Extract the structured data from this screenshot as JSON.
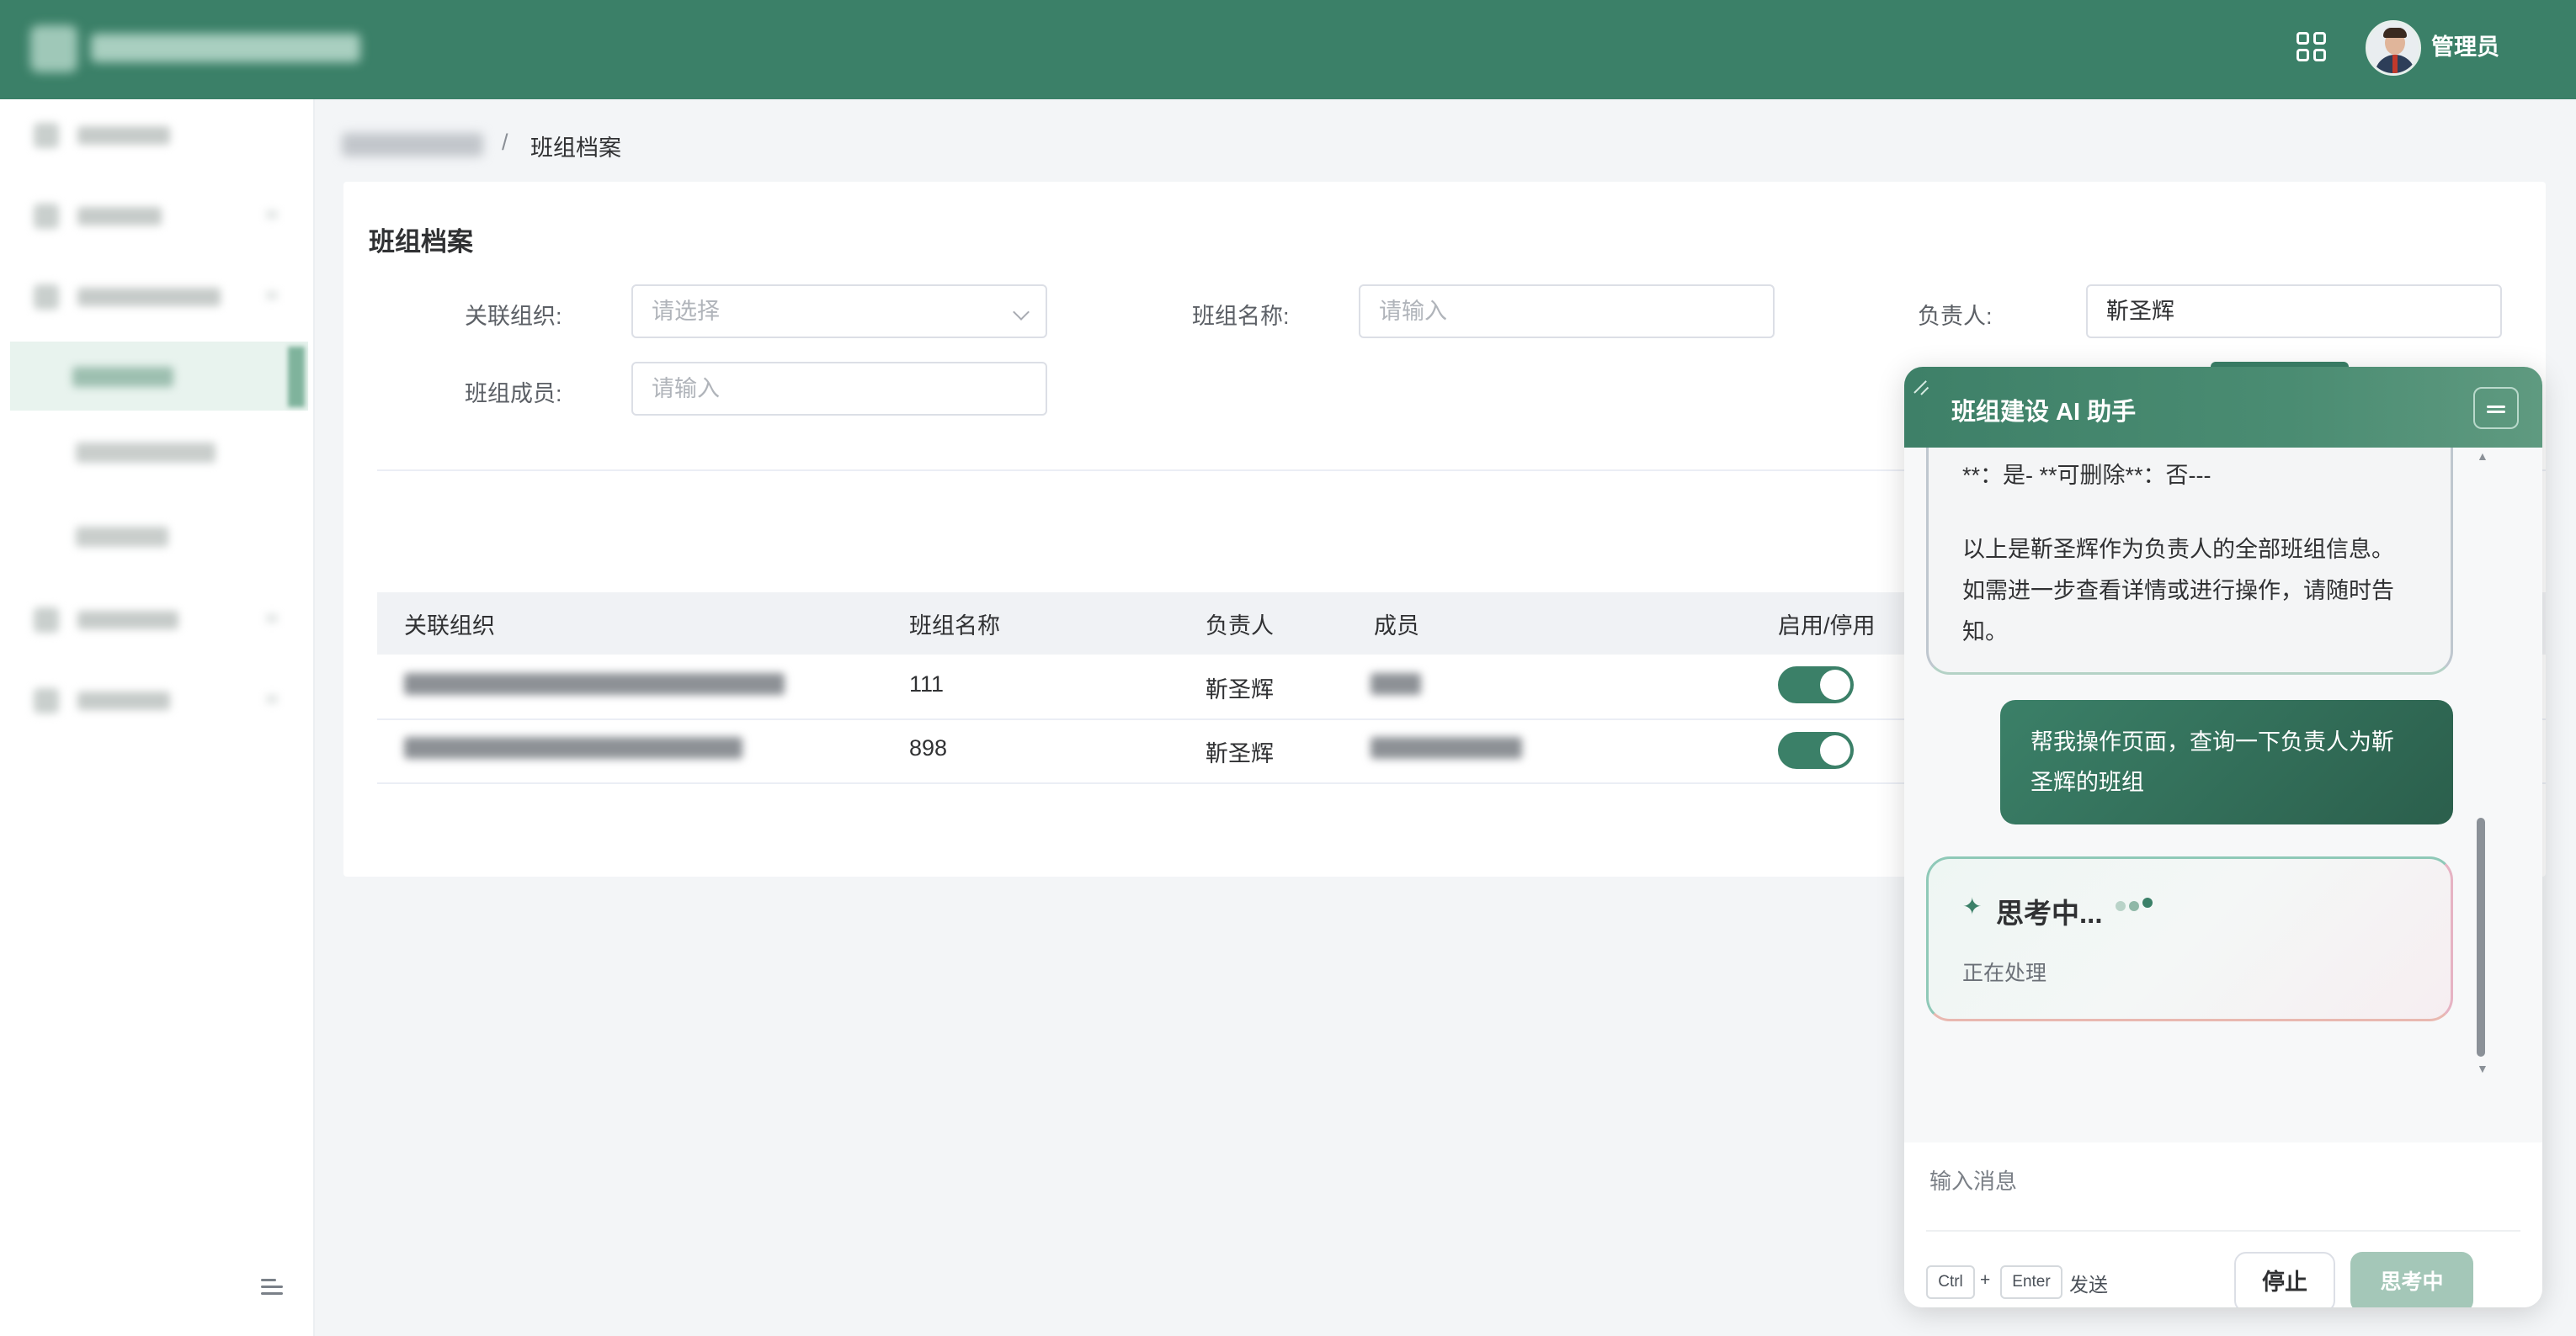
{
  "topbar": {
    "user_name": "管理员"
  },
  "breadcrumb": {
    "separator": "/",
    "current": "班组档案"
  },
  "page": {
    "title": "班组档案"
  },
  "filters": {
    "org_label": "关联组织:",
    "org_placeholder": "请选择",
    "team_name_label": "班组名称:",
    "team_name_placeholder": "请输入",
    "leader_label": "负责人:",
    "leader_value": "靳圣辉",
    "member_label": "班组成员:",
    "member_placeholder": "请输入"
  },
  "table": {
    "columns": [
      "关联组织",
      "班组名称",
      "负责人",
      "成员",
      "启用/停用"
    ],
    "rows": [
      {
        "team_name": "111",
        "leader": "靳圣辉",
        "enabled": true
      },
      {
        "team_name": "898",
        "leader": "靳圣辉",
        "enabled": true
      }
    ]
  },
  "assistant": {
    "title": "班组建设 AI 助手",
    "bot_lines": [
      "**：是- **可删除**：否---",
      "以上是靳圣辉作为负责人的全部班组信息。",
      "如需进一步查看详情或进行操作，请随时告",
      "知。"
    ],
    "user_lines": [
      "帮我操作页面，查询一下负责人为靳",
      "圣辉的班组"
    ],
    "thinking_star": "✦",
    "thinking_title": "思考中...",
    "thinking_status": "正在处理",
    "input_placeholder": "输入消息",
    "shortcut_ctrl": "Ctrl",
    "shortcut_plus": "+",
    "shortcut_enter": "Enter",
    "shortcut_send": "发送",
    "stop_label": "停止",
    "thinking_button_label": "思考中"
  },
  "colors": {
    "brand": "#3b8068",
    "switch_on": "#3b8068",
    "user_bubble": "#2f6a55",
    "thinking_button": "#a4c7b8"
  },
  "icons": {
    "apps": "apps-grid-icon",
    "collapse": "sidebar-collapse-icon",
    "minimize": "minimize-icon",
    "resize": "resize-handle-icon",
    "dropdown": "chevron-down-icon"
  }
}
